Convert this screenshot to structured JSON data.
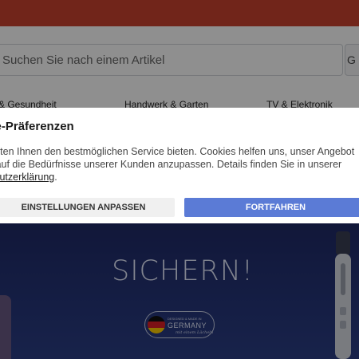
{
  "header": {
    "bar_color": "#c9432f"
  },
  "search": {
    "placeholder": "Suchen Sie nach einem Artikel",
    "button_label": "G"
  },
  "categories": [
    {
      "label": "& Gesundheit"
    },
    {
      "label": "Handwerk & Garten"
    },
    {
      "label": "TV & Elektronik"
    }
  ],
  "hero": {
    "headline": "SICHERN!",
    "badge": {
      "small_text": "DESIGNED & MADE IN",
      "big_text": "GERMANY",
      "signature": "mit einem Lächeln"
    }
  },
  "cookie_modal": {
    "title": "kie-Präferenzen",
    "text_line1": "öchten Ihnen den bestmöglichen Service bieten. Cookies helfen uns, unser Angebot",
    "text_line2": "er auf die Bedürfnisse unserer Kunden anzupassen. Details finden Sie in unserer",
    "privacy_link": "schutzerklärung",
    "text_tail": ".",
    "customize_button": "EINSTELLUNGEN ANPASSEN",
    "continue_button": "FORTFAHREN"
  },
  "colors": {
    "brand_red": "#c9432f",
    "primary_button": "#5b7bd6",
    "hero_background": "#26367a"
  },
  "icons": {
    "flag": "germany-flag-icon",
    "product": "electric-toothbrush"
  }
}
